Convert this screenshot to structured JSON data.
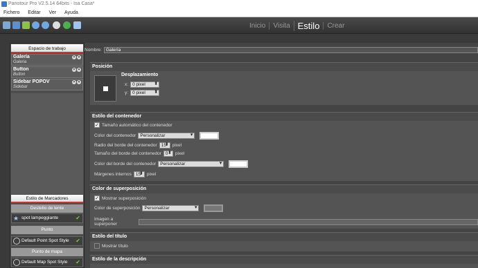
{
  "window": {
    "title": "Panotour Pro V2.5.14 64bits - Isa Casa*"
  },
  "menu": [
    "Fichero",
    "Editar",
    "Ver",
    "Ayuda"
  ],
  "nav_tabs": [
    {
      "label": "Inicio",
      "active": false
    },
    {
      "label": "Visita",
      "active": false
    },
    {
      "label": "Estilo",
      "active": true
    },
    {
      "label": "Crear",
      "active": false
    }
  ],
  "sidebar": {
    "workspace_header": "Espacio de trabajo",
    "items": [
      {
        "title": "Galería",
        "subtitle": "Galeria"
      },
      {
        "title": "Button",
        "subtitle": "Button"
      },
      {
        "title": "Sidebar POPOV",
        "subtitle": "Sidebar"
      }
    ],
    "markers_header": "Estilo de Marcadores",
    "groups": [
      {
        "label": "Destello de lente",
        "row": "spot lampeggiante"
      },
      {
        "label": "Punto",
        "row": "Default Point Spot Style"
      },
      {
        "label": "Punto de mapa",
        "row": "Default Map Spot Style"
      }
    ]
  },
  "main": {
    "name_label": "Nombre:",
    "name_value": "Galería",
    "position": {
      "title": "Posición",
      "displacement_label": "Desplazamiento",
      "x_label": "x:",
      "x_value": "0 pixel",
      "y_label": "y:",
      "y_value": "0 pixel"
    },
    "container": {
      "title": "Estilo del contenedor",
      "auto_size_label": "Tamaño automático del contenedor",
      "auto_size_checked": true,
      "color_label": "Color del contenedor",
      "color_value": "Personalizar",
      "radius_label": "Radio del borde del contenedor",
      "radius_value": "15",
      "border_size_label": "Tamaño del borde del contenedor",
      "border_size_value": "0",
      "border_color_label": "Color del borde del contenedor",
      "border_color_value": "Personalizar",
      "padding_label": "Márgenes internos",
      "padding_value": "15",
      "unit": "pixel"
    },
    "overlay": {
      "title": "Color de superposición",
      "show_label": "Mostrar superposición",
      "show_checked": true,
      "color_label": "Color de superposición",
      "color_value": "Personalizar",
      "image_label": "Imagen a superponer"
    },
    "title_style": {
      "title": "Estilo del título",
      "show_label": "Mostrar título",
      "show_checked": false
    },
    "description_style": {
      "title": "Estilo de la descripción"
    }
  }
}
